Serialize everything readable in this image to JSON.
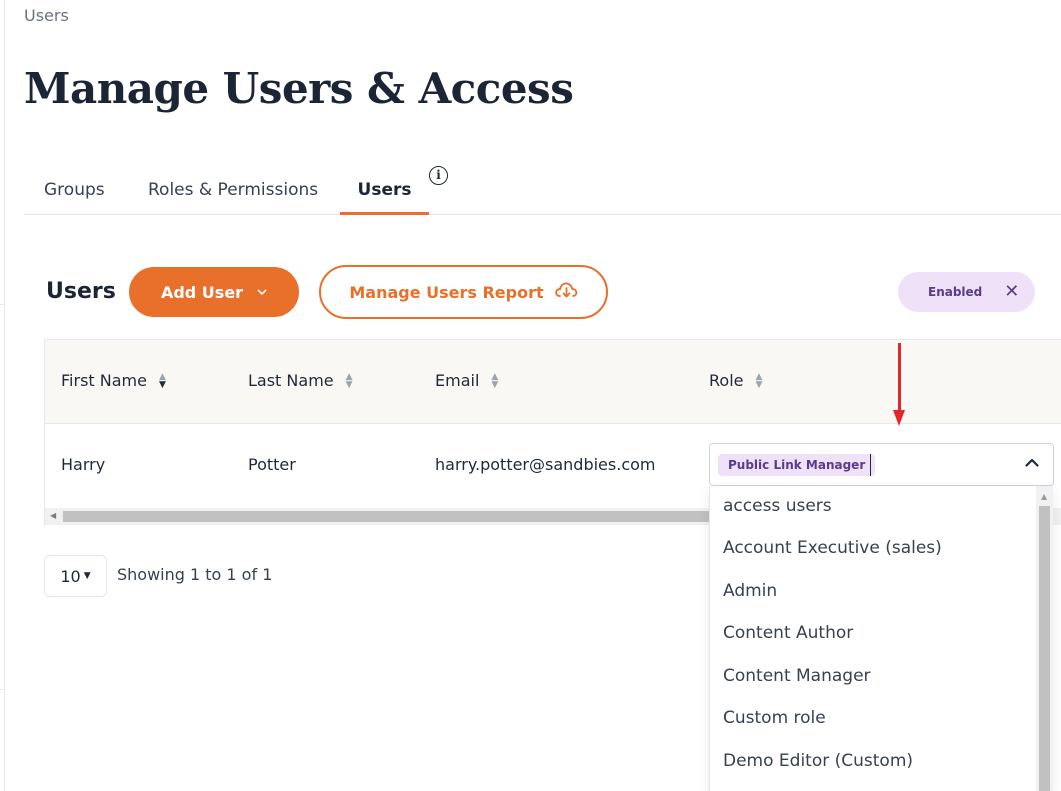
{
  "breadcrumb": "Users",
  "page_title": "Manage Users & Access",
  "tabs": [
    {
      "label": "Groups"
    },
    {
      "label": "Roles & Permissions"
    },
    {
      "label": "Users",
      "active": true
    }
  ],
  "icons": {
    "info": "i",
    "chevron_down": "⌄",
    "chevron_up": "⌃",
    "close": "✕",
    "cloud_download": "cloud-download-icon"
  },
  "section": {
    "title": "Users",
    "add_button": "Add User",
    "report_button": "Manage Users Report"
  },
  "filter_chip": {
    "label": "Enabled"
  },
  "table": {
    "columns": [
      "First Name",
      "Last Name",
      "Email",
      "Role"
    ],
    "rows": [
      {
        "first": "Harry",
        "last": "Potter",
        "email": "harry.potter@sandbies.com"
      }
    ]
  },
  "role_select": {
    "selected_tag": "Public Link Manager",
    "options": [
      "access users",
      "Account Executive (sales)",
      "Admin",
      "Content Author",
      "Content Manager",
      "Custom role",
      "Demo Editor (Custom)"
    ]
  },
  "pagination": {
    "page_size": "10",
    "showing": "Showing 1 to 1 of 1"
  },
  "colors": {
    "accent": "#e8702a",
    "tag_bg": "#efe2f8",
    "tag_text": "#5b3a8a",
    "annotation_arrow": "#e3262b"
  }
}
